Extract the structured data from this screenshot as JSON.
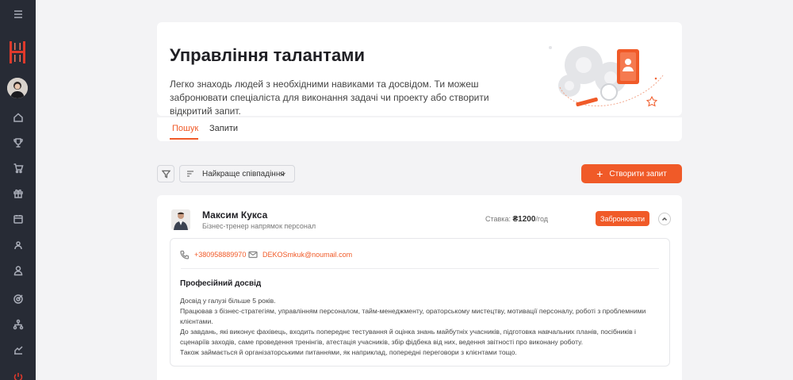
{
  "sidebar": {
    "icons": [
      "menu-icon",
      "home-icon",
      "trophy-icon",
      "cart-icon",
      "gift-icon",
      "calendar-icon",
      "users-icon",
      "user-icon",
      "target-icon",
      "hierarchy-icon",
      "chart-icon",
      "power-icon"
    ]
  },
  "hero": {
    "title": "Управління талантами",
    "description": "Легко знаходь людей з необхідними навиками та досвідом. Ти можеш забронювати спеціаліста для виконання задачі чи проекту або створити відкритий запит."
  },
  "tabs": [
    {
      "label": "Пошук",
      "active": true
    },
    {
      "label": "Запити",
      "active": false
    }
  ],
  "toolbar": {
    "sort_label": "Найкраще співпадіння",
    "create_label": "Створити запит"
  },
  "talent": {
    "name": "Максим Кукса",
    "role": "Бізнес-тренер напрямок персонал",
    "rate_label": "Ставка:",
    "rate_value": "₴1200",
    "rate_unit": "/год",
    "book_label": "Забронювати",
    "phone": "+380958889970",
    "email": "DEKOSmkuk@noumail.com",
    "experience_title": "Професійний досвід",
    "experience_lines": [
      "Досвід у галузі більше 5 років.",
      "Працював з бізнес-стратегіям, управлінням персоналом, тайм-менеджменту, ораторському мистецтву, мотивації персоналу, роботі з проблемними клієнтами.",
      "До завдань, які виконує фахівець, входить попереднє тестування й оцінка знань майбутніх учасників, підготовка навчальних планів, посібників і сценаріїв заходів, саме проведення тренінгів, атестація учасників, збір фідбека від них, ведення звітності про виконану роботу.",
      "Також займається й організаторськими питаннями, як наприклад, попередні переговори з клієнтами тощо."
    ]
  },
  "colors": {
    "accent": "#f05a28",
    "sidebar": "#272b35",
    "background": "#f3f3f5"
  }
}
